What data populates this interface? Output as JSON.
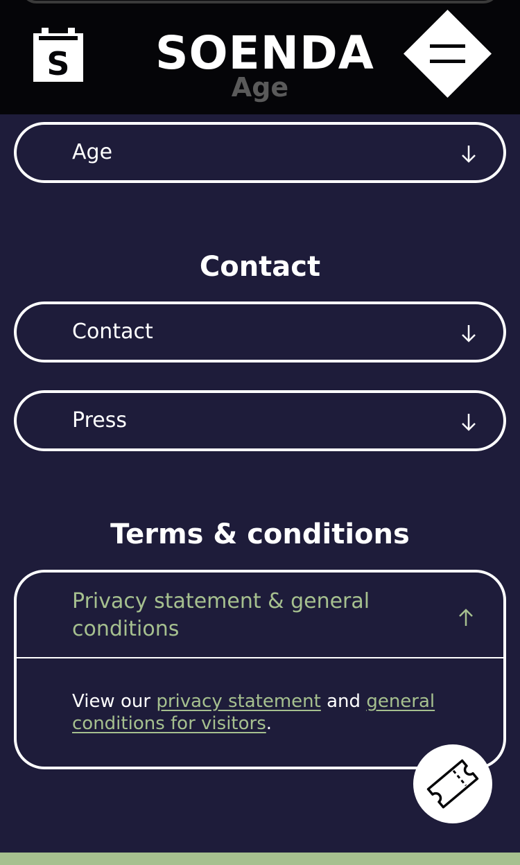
{
  "header": {
    "brand": "SOENDA",
    "ghost_title": "Age",
    "logo_icon": "calendar-s-logo",
    "menu_icon": "hamburger-icon"
  },
  "sections": {
    "age_accordion": {
      "label": "Age",
      "icon": "arrow-down-icon"
    },
    "contact_title": "Contact",
    "contact_accordion": {
      "label": "Contact",
      "icon": "arrow-down-icon"
    },
    "press_accordion": {
      "label": "Press",
      "icon": "arrow-down-icon"
    },
    "terms_title": "Terms & conditions",
    "privacy_accordion": {
      "label": "Privacy statement & general conditions",
      "icon": "arrow-up-icon",
      "body_prefix": "View our",
      "link1": "privacy statement",
      "body_mid": "and",
      "link2": "general conditions for visitors",
      "body_suffix": "."
    }
  },
  "fab": {
    "icon": "ticket-icon"
  },
  "colors": {
    "background": "#1e1c3a",
    "header": "#050508",
    "accent_green": "#a6c08f",
    "white": "#ffffff"
  }
}
